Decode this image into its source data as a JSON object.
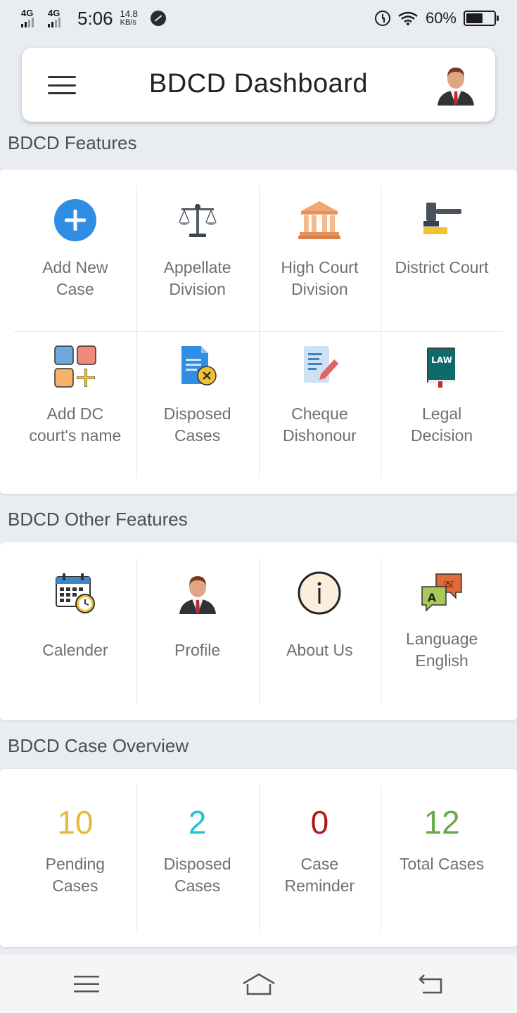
{
  "status_bar": {
    "net1": "4G",
    "net2": "4G",
    "time": "5:06",
    "speed_value": "14.8",
    "speed_unit": "KB/s",
    "battery_text": "60%",
    "battery_level": 0.6
  },
  "header": {
    "title": "BDCD Dashboard",
    "menu_icon": "hamburger-icon",
    "avatar_icon": "user-avatar-icon"
  },
  "features": {
    "title": "BDCD Features",
    "items": [
      {
        "label": "Add New Case",
        "icon": "add-circle-icon"
      },
      {
        "label": "Appellate Division",
        "icon": "scales-icon"
      },
      {
        "label": "High Court Division",
        "icon": "courthouse-icon"
      },
      {
        "label": "District Court",
        "icon": "gavel-icon"
      },
      {
        "label": "Add DC court's name",
        "icon": "add-grid-icon"
      },
      {
        "label": "Disposed Cases",
        "icon": "document-cancel-icon"
      },
      {
        "label": "Cheque Dishonour",
        "icon": "document-pen-icon"
      },
      {
        "label": "Legal Decision",
        "icon": "law-book-icon"
      }
    ]
  },
  "other_features": {
    "title": "BDCD Other Features",
    "items": [
      {
        "label": "Calender",
        "icon": "calendar-clock-icon"
      },
      {
        "label": "Profile",
        "icon": "profile-icon"
      },
      {
        "label": "About Us",
        "icon": "info-icon"
      },
      {
        "label": "Language English",
        "icon": "translate-icon",
        "glyph_a": "A",
        "glyph_b": "অ"
      }
    ]
  },
  "overview": {
    "title": "BDCD Case Overview",
    "items": [
      {
        "value": "10",
        "label": "Pending Cases",
        "color": "#e6b93a"
      },
      {
        "value": "2",
        "label": "Disposed Cases",
        "color": "#22c3d6"
      },
      {
        "value": "0",
        "label": "Case Reminder",
        "color": "#b5161b"
      },
      {
        "value": "12",
        "label": "Total Cases",
        "color": "#6aa84f"
      }
    ]
  },
  "nav": {
    "menu_icon": "menu-icon",
    "home_icon": "home-icon",
    "back_icon": "back-icon"
  }
}
